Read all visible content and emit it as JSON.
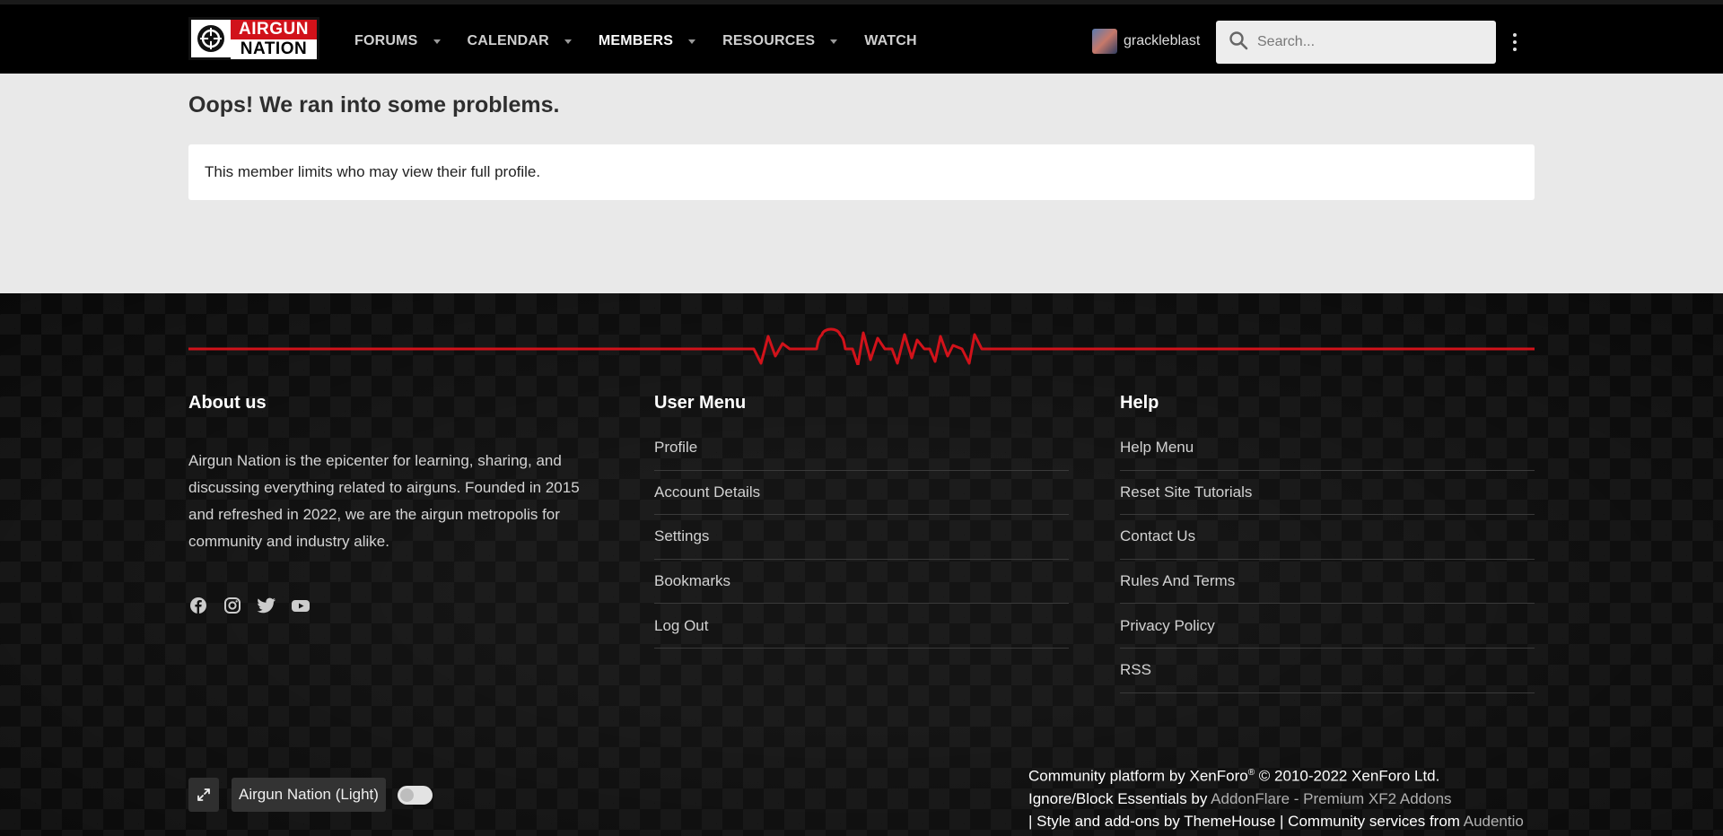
{
  "header": {
    "logo_top": "AIRGUN",
    "logo_bottom": "NATION",
    "nav": [
      {
        "label": "FORUMS",
        "has_caret": true
      },
      {
        "label": "CALENDAR",
        "has_caret": true
      },
      {
        "label": "MEMBERS",
        "has_caret": true,
        "active": true
      },
      {
        "label": "RESOURCES",
        "has_caret": true
      },
      {
        "label": "WATCH",
        "has_caret": false
      }
    ],
    "username": "grackleblast",
    "search_placeholder": "Search..."
  },
  "main": {
    "title": "Oops! We ran into some problems.",
    "notice": "This member limits who may view their full profile."
  },
  "footer": {
    "about": {
      "title": "About us",
      "text": "Airgun Nation is the epicenter for learning, sharing, and discussing everything related to airguns. Founded in 2015 and refreshed in 2022, we are the airgun metropolis for community and industry alike."
    },
    "user_menu": {
      "title": "User Menu",
      "items": [
        "Profile",
        "Account Details",
        "Settings",
        "Bookmarks",
        "Log Out"
      ]
    },
    "help": {
      "title": "Help",
      "items": [
        "Help Menu",
        "Reset Site Tutorials",
        "Contact Us",
        "Rules And Terms",
        "Privacy Policy",
        "RSS"
      ]
    },
    "style_name": "Airgun Nation (Light)",
    "copyright": {
      "line1_a": "Community platform by XenForo",
      "line1_sup": "®",
      "line1_b": " © 2010-2022 XenForo Ltd.",
      "line2_a": "Ignore/Block Essentials by ",
      "line2_link": "AddonFlare - Premium XF2 Addons",
      "line3_a": "| Style and add-ons by ThemeHouse | Community services from ",
      "line3_link": "Audentio"
    }
  },
  "colors": {
    "accent_red": "#d1121a",
    "header_bg": "#000000",
    "page_bg": "#e9e9e9"
  }
}
